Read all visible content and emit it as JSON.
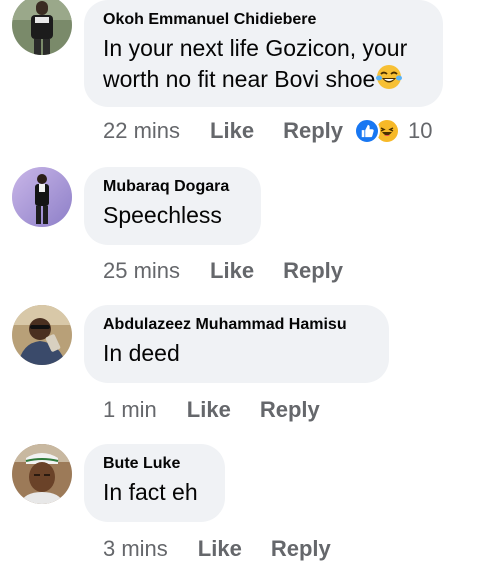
{
  "comments": [
    {
      "author": "Okoh Emmanuel Chidiebere",
      "text": "In your next life Gozicon, your worth no fit near Bovi shoe",
      "text_line1": "In your next life Gozicon, your",
      "text_line2": "worth no fit near Bovi shoe",
      "time": "22 mins",
      "like_label": "Like",
      "reply_label": "Reply",
      "reactions": [
        "like",
        "haha"
      ],
      "reaction_count": "10"
    },
    {
      "author": "Mubaraq Dogara",
      "text": "Speechless",
      "time": "25 mins",
      "like_label": "Like",
      "reply_label": "Reply"
    },
    {
      "author": "Abdulazeez Muhammad Hamisu",
      "text": "In deed",
      "time": "1 min",
      "like_label": "Like",
      "reply_label": "Reply"
    },
    {
      "author": "Bute Luke",
      "text": "In fact eh",
      "time": "3 mins",
      "like_label": "Like",
      "reply_label": "Reply"
    }
  ],
  "colors": {
    "bubble": "#f0f2f5",
    "meta_text": "#65676b",
    "like_blue": "#1877f2",
    "haha_yellow": "#f7b928"
  }
}
